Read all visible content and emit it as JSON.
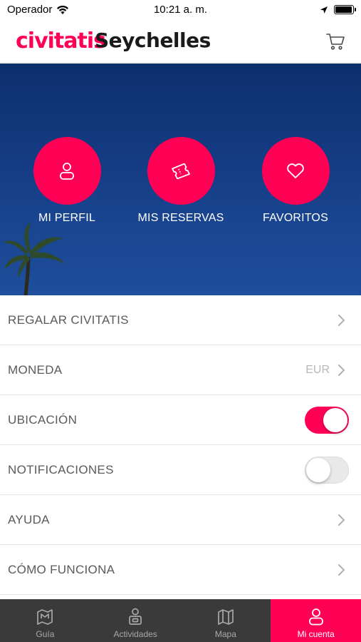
{
  "status_bar": {
    "carrier": "Operador",
    "time": "10:21 a. m.",
    "battery_level": 0.95
  },
  "header": {
    "logo": "civitatis",
    "destination": "Seychelles",
    "cart_icon": "cart-icon"
  },
  "hero": {
    "buttons": [
      {
        "label": "MI PERFIL",
        "icon": "user-icon"
      },
      {
        "label": "MIS RESERVAS",
        "icon": "ticket-icon"
      },
      {
        "label": "FAVORITOS",
        "icon": "heart-icon"
      }
    ]
  },
  "settings": {
    "items": [
      {
        "label": "REGALAR CIVITATIS",
        "type": "link"
      },
      {
        "label": "MONEDA",
        "type": "value",
        "value": "EUR"
      },
      {
        "label": "UBICACIÓN",
        "type": "toggle",
        "on": true
      },
      {
        "label": "NOTIFICACIONES",
        "type": "toggle",
        "on": false
      },
      {
        "label": "AYUDA",
        "type": "link"
      },
      {
        "label": "CÓMO FUNCIONA",
        "type": "link"
      }
    ]
  },
  "tab_bar": {
    "tabs": [
      {
        "label": "Guía",
        "icon": "guide-icon",
        "active": false
      },
      {
        "label": "Actividades",
        "icon": "activities-icon",
        "active": false
      },
      {
        "label": "Mapa",
        "icon": "map-icon",
        "active": false
      },
      {
        "label": "Mi cuenta",
        "icon": "account-icon",
        "active": true
      }
    ]
  },
  "colors": {
    "brand": "#ff0055",
    "tabbar_bg": "#3a3a3a",
    "hero_bg": "#17408a"
  }
}
